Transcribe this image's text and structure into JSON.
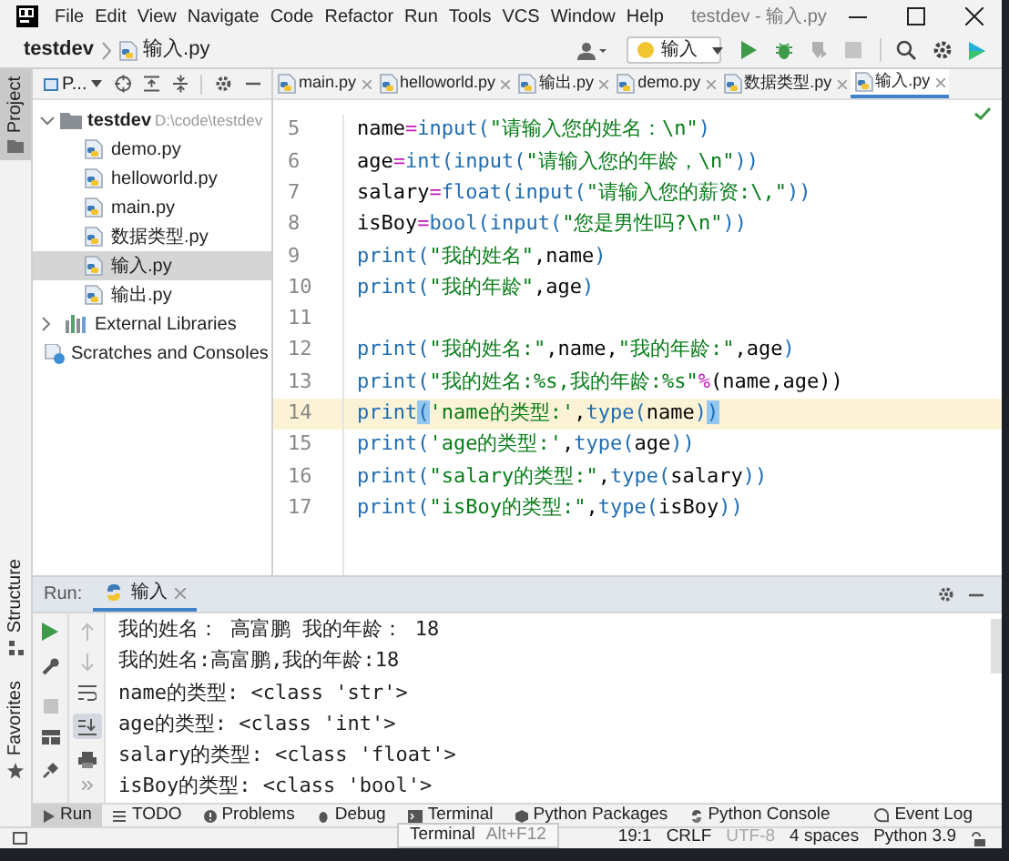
{
  "title_bar": {
    "menu": [
      {
        "label": "File"
      },
      {
        "label": "Edit"
      },
      {
        "label": "View"
      },
      {
        "label": "Navigate"
      },
      {
        "label": "Code"
      },
      {
        "label": "Refactor"
      },
      {
        "label": "Run"
      },
      {
        "label": "Tools"
      },
      {
        "label": "VCS"
      },
      {
        "label": "Window"
      },
      {
        "label": "Help"
      }
    ],
    "title": "testdev - 输入.py"
  },
  "nav_bar": {
    "breadcrumbs": [
      "testdev",
      "输入.py"
    ],
    "run_config": "输入",
    "actions": [
      {
        "kind": "run",
        "disabled": false
      },
      {
        "kind": "debug",
        "disabled": false
      },
      {
        "kind": "coverage",
        "disabled": true
      },
      {
        "kind": "stop",
        "disabled": true
      }
    ]
  },
  "side_tabs": [
    {
      "label": "Project",
      "selected": true,
      "kind": "project"
    },
    {
      "label": "Structure",
      "selected": false,
      "kind": "structure"
    },
    {
      "label": "Favorites",
      "selected": false,
      "kind": "favorites"
    }
  ],
  "project": {
    "view_label": "P...",
    "tree": [
      {
        "label": "testdev",
        "path": "D:\\code\\testdev",
        "kind": "folder",
        "expanded": true,
        "selected": false,
        "children": [
          {
            "label": "demo.py",
            "kind": "python",
            "selected": false
          },
          {
            "label": "helloworld.py",
            "kind": "python",
            "selected": false
          },
          {
            "label": "main.py",
            "kind": "python",
            "selected": false
          },
          {
            "label": "数据类型.py",
            "kind": "python",
            "selected": false
          },
          {
            "label": "输入.py",
            "kind": "python",
            "selected": true
          },
          {
            "label": "输出.py",
            "kind": "python",
            "selected": false
          }
        ]
      },
      {
        "label": "External Libraries",
        "kind": "libraries",
        "expanded": false,
        "selected": false
      },
      {
        "label": "Scratches and Consoles",
        "kind": "scratches",
        "selected": false
      }
    ]
  },
  "editor": {
    "tabs": [
      {
        "label": "main.py",
        "selected": false
      },
      {
        "label": "helloworld.py",
        "selected": false
      },
      {
        "label": "输出.py",
        "selected": false
      },
      {
        "label": "demo.py",
        "selected": false
      },
      {
        "label": "数据类型.py",
        "selected": false
      },
      {
        "label": "输入.py",
        "selected": true
      }
    ],
    "lines": [
      {
        "number": "5",
        "current": false,
        "tokens": [
          {
            "text": "name",
            "kind": "name"
          },
          {
            "text": "=",
            "kind": "operator"
          },
          {
            "text": "input(",
            "kind": "builtin"
          },
          {
            "text": "\"请输入您的姓名：\\n\"",
            "kind": "string"
          },
          {
            "text": ")",
            "kind": "builtin"
          }
        ]
      },
      {
        "number": "6",
        "current": false,
        "tokens": [
          {
            "text": "age",
            "kind": "name"
          },
          {
            "text": "=",
            "kind": "operator"
          },
          {
            "text": "int(input(",
            "kind": "builtin"
          },
          {
            "text": "\"请输入您的年龄，\\n\"",
            "kind": "string"
          },
          {
            "text": "))",
            "kind": "builtin"
          }
        ]
      },
      {
        "number": "7",
        "current": false,
        "tokens": [
          {
            "text": "salary",
            "kind": "name"
          },
          {
            "text": "=",
            "kind": "operator"
          },
          {
            "text": "float(input(",
            "kind": "builtin"
          },
          {
            "text": "\"请输入您的薪资:\\,\"",
            "kind": "string"
          },
          {
            "text": "))",
            "kind": "builtin"
          }
        ]
      },
      {
        "number": "8",
        "current": false,
        "tokens": [
          {
            "text": "isBoy",
            "kind": "name"
          },
          {
            "text": "=",
            "kind": "operator"
          },
          {
            "text": "bool(input(",
            "kind": "builtin"
          },
          {
            "text": "\"您是男性吗?\\n\"",
            "kind": "string"
          },
          {
            "text": "))",
            "kind": "builtin"
          }
        ]
      },
      {
        "number": "9",
        "current": false,
        "tokens": [
          {
            "text": "print(",
            "kind": "builtin"
          },
          {
            "text": "\"我的姓名\"",
            "kind": "string"
          },
          {
            "text": ",name",
            "kind": "name"
          },
          {
            "text": ")",
            "kind": "builtin"
          }
        ]
      },
      {
        "number": "10",
        "current": false,
        "tokens": [
          {
            "text": "print(",
            "kind": "builtin"
          },
          {
            "text": "\"我的年龄\"",
            "kind": "string"
          },
          {
            "text": ",age",
            "kind": "name"
          },
          {
            "text": ")",
            "kind": "builtin"
          }
        ]
      },
      {
        "number": "11",
        "current": false
      },
      {
        "number": "12",
        "current": false,
        "tokens": [
          {
            "text": "print(",
            "kind": "builtin"
          },
          {
            "text": "\"我的姓名:\"",
            "kind": "string"
          },
          {
            "text": ",name,",
            "kind": "name"
          },
          {
            "text": "\"我的年龄:\"",
            "kind": "string"
          },
          {
            "text": ",age",
            "kind": "name"
          },
          {
            "text": ")",
            "kind": "builtin"
          }
        ]
      },
      {
        "number": "13",
        "current": false,
        "tokens": [
          {
            "text": "print(",
            "kind": "builtin"
          },
          {
            "text": "\"我的姓名:%s,我的年龄:%s\"",
            "kind": "string"
          },
          {
            "text": "%",
            "kind": "operator"
          },
          {
            "text": "(name,age))",
            "kind": "name"
          }
        ]
      },
      {
        "number": "14",
        "current": true,
        "tokens": [
          {
            "text": "print",
            "kind": "builtin"
          },
          {
            "text": "(",
            "kind": "brace_match"
          },
          {
            "text": "'name的类型:'",
            "kind": "string"
          },
          {
            "text": ",",
            "kind": "name"
          },
          {
            "text": "type(",
            "kind": "builtin"
          },
          {
            "text": "name",
            "kind": "name"
          },
          {
            "text": ")",
            "kind": "builtin"
          },
          {
            "text": ")",
            "kind": "brace_match"
          }
        ]
      },
      {
        "number": "15",
        "current": false,
        "tokens": [
          {
            "text": "print(",
            "kind": "builtin"
          },
          {
            "text": "'age的类型:'",
            "kind": "string"
          },
          {
            "text": ",",
            "kind": "name"
          },
          {
            "text": "type(",
            "kind": "builtin"
          },
          {
            "text": "age",
            "kind": "name"
          },
          {
            "text": "))",
            "kind": "builtin"
          }
        ]
      },
      {
        "number": "16",
        "current": false,
        "tokens": [
          {
            "text": "print(",
            "kind": "builtin"
          },
          {
            "text": "\"salary的类型:\"",
            "kind": "string"
          },
          {
            "text": ",",
            "kind": "name"
          },
          {
            "text": "type(",
            "kind": "builtin"
          },
          {
            "text": "salary",
            "kind": "name"
          },
          {
            "text": "))",
            "kind": "builtin"
          }
        ]
      },
      {
        "number": "17",
        "current": false,
        "tokens": [
          {
            "text": "print(",
            "kind": "builtin"
          },
          {
            "text": "\"isBoy的类型:\"",
            "kind": "string"
          },
          {
            "text": ",",
            "kind": "name"
          },
          {
            "text": "type(",
            "kind": "builtin"
          },
          {
            "text": "isBoy",
            "kind": "name"
          },
          {
            "text": "))",
            "kind": "builtin"
          }
        ]
      }
    ]
  },
  "run_panel": {
    "label": "Run:",
    "tab": "输入",
    "output": [
      "我的姓名： 高富鹏 我的年龄： 18",
      "我的姓名:高富鹏,我的年龄:18",
      "name的类型: <class 'str'>",
      "age的类型: <class 'int'>",
      "salary的类型: <class 'float'>",
      "isBoy的类型: <class 'bool'>"
    ]
  },
  "bottom_tabs": [
    {
      "label": "Run",
      "kind": "run",
      "selected": true
    },
    {
      "label": "TODO",
      "kind": "todo",
      "selected": false
    },
    {
      "label": "Problems",
      "kind": "problems",
      "selected": false
    },
    {
      "label": "Debug",
      "kind": "debug",
      "selected": false
    },
    {
      "label": "Terminal",
      "kind": "terminal",
      "selected": false
    },
    {
      "label": "Python Packages",
      "kind": "packages",
      "selected": false
    },
    {
      "label": "Python Console",
      "kind": "console",
      "selected": false
    },
    {
      "label": "Event Log",
      "kind": "log",
      "selected": false
    }
  ],
  "tooltip": {
    "label": "Terminal",
    "shortcut": "Alt+F12"
  },
  "status_bar": [
    {
      "text": "19:1",
      "disabled": false
    },
    {
      "text": "CRLF",
      "disabled": false
    },
    {
      "text": "UTF-8",
      "disabled": true
    },
    {
      "text": "4 spaces",
      "disabled": false
    },
    {
      "text": "Python 3.9",
      "disabled": false
    }
  ]
}
